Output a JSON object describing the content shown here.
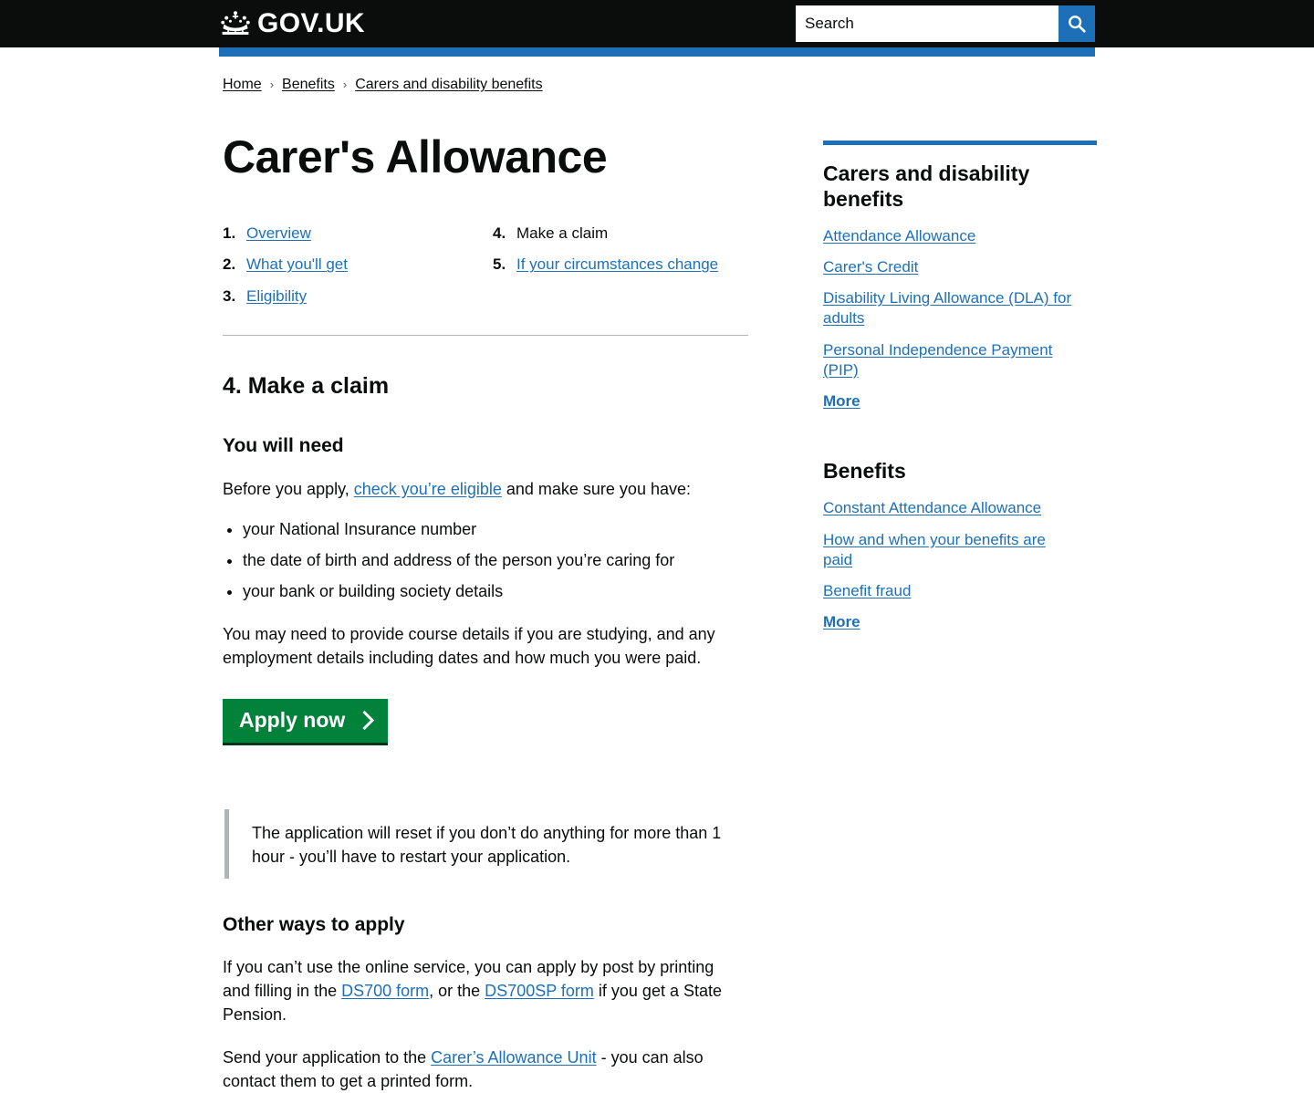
{
  "header": {
    "logo_text": "GOV.UK",
    "crown_icon": "crown-icon",
    "search_placeholder": "Search",
    "search_value": "",
    "search_icon": "search-icon",
    "accent_blue": "#1d70b8",
    "black": "#0b0c0c"
  },
  "breadcrumbs": [
    {
      "label": "Home"
    },
    {
      "label": "Benefits"
    },
    {
      "label": "Carers and disability benefits"
    }
  ],
  "breadcrumb_separator": "›",
  "main": {
    "title": "Carer's Allowance",
    "part_nav": {
      "column1": [
        {
          "number": "1.",
          "label": "Overview",
          "current": false
        },
        {
          "number": "2.",
          "label": "What you'll get",
          "current": false
        },
        {
          "number": "3.",
          "label": "Eligibility",
          "current": false
        }
      ],
      "column2": [
        {
          "number": "4.",
          "label": "Make a claim",
          "current": true
        },
        {
          "number": "5.",
          "label": "If your circumstances change",
          "current": false
        }
      ]
    },
    "section_heading": "4. Make a claim",
    "you_will_need": {
      "heading": "You will need",
      "intro_before": "Before you apply, ",
      "intro_link": "check you’re eligible",
      "intro_after": " and make sure you have:",
      "bullets": [
        "your National Insurance number",
        "the date of birth and address of the person you’re caring for",
        "your bank or building society details"
      ],
      "note": "You may need to provide course details if you are studying, and any employment details including dates and how much you were paid."
    },
    "apply_button": {
      "label": "Apply now",
      "icon": "chevron-right-icon",
      "color": "#00823b"
    },
    "inset_text": "The application will reset if you don’t do anything for more than 1 hour - you’ll have to restart your application.",
    "other_ways": {
      "heading": "Other ways to apply",
      "para1_part1": "If you can’t use the online service, you can apply by post by printing and filling in the ",
      "para1_link1": "DS700 form",
      "para1_part2": ", or the ",
      "para1_link2": "DS700SP form",
      "para1_part3": " if you get a State Pension.",
      "para2_part1": "Send your application to the ",
      "para2_link1": "Carer’s Allowance Unit",
      "para2_part2": " - you can also contact them to get a printed form."
    }
  },
  "sidebar": {
    "section1": {
      "title": "Carers and disability benefits",
      "links": [
        {
          "label": "Attendance Allowance",
          "bold": false
        },
        {
          "label": "Carer's Credit",
          "bold": false
        },
        {
          "label": "Disability Living Allowance (DLA) for adults",
          "bold": false
        },
        {
          "label": "Personal Independence Payment (PIP)",
          "bold": false
        },
        {
          "label": "More",
          "bold": true
        }
      ]
    },
    "section2": {
      "title": "Benefits",
      "links": [
        {
          "label": "Constant Attendance Allowance",
          "bold": false
        },
        {
          "label": "How and when your benefits are paid",
          "bold": false
        },
        {
          "label": "Benefit fraud",
          "bold": false
        },
        {
          "label": "More",
          "bold": true
        }
      ]
    }
  }
}
